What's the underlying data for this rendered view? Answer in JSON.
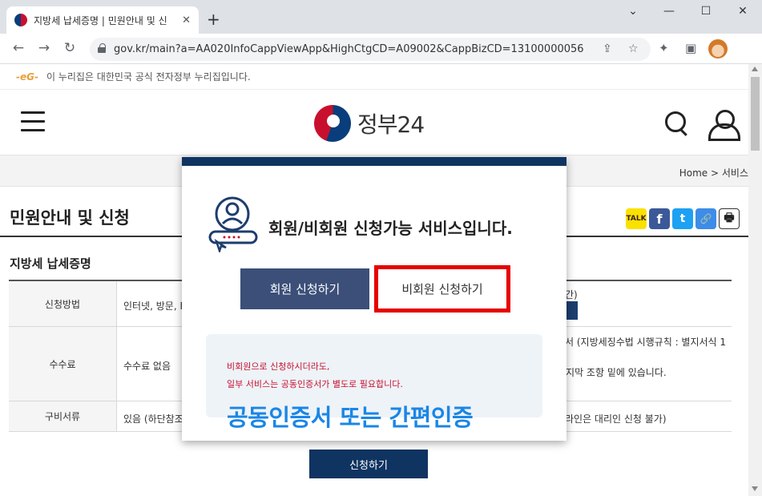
{
  "browser": {
    "tab_title": "지방세 납세증명 | 민원안내 및 신",
    "tab_close": "✕",
    "new_tab": "+",
    "url": "gov.kr/main?a=AA020InfoCappViewApp&HighCtgCD=A09002&CappBizCD=13100000056"
  },
  "banner": {
    "mark": "-eG-",
    "text": "이 누리집은 대한민국 공식 전자정부 누리집입니다."
  },
  "header": {
    "logo_text": "정부24"
  },
  "breadcrumb": "Home  >  서비스",
  "page": {
    "title": "민원안내 및 신청",
    "subtitle": "지방세 납세증명",
    "share": [
      "TALK",
      "f",
      "t",
      "🔗",
      "🖶"
    ],
    "rows": [
      {
        "header": "신청방법",
        "value": "인터넷, 방문, FA",
        "right": "간)"
      },
      {
        "header": "수수료",
        "value": "수수료 없음",
        "right": "서 (지방세징수법 시행규칙 : 별지서식 1",
        "right2": "마지막 조항 밑에 있습니다."
      },
      {
        "header": "구비서류",
        "value": "있음 (하단참조)",
        "right": "라인은 대리인 신청 불가)"
      }
    ],
    "apply_button": "신청하기"
  },
  "modal": {
    "heading": "회원/비회원 신청가능 서비스입니다.",
    "member_button": "회원 신청하기",
    "guest_button": "비회원 신청하기",
    "notice_line1": "비회원으로 신청하시더라도,",
    "notice_line2": "일부 서비스는 공동인증서가 별도로 필요합니다."
  },
  "overlay_caption": "공동인증서 또는 간편인증",
  "colors": {
    "navy": "#0f3461",
    "member_btn": "#3b4f78",
    "highlight_red": "#e60000",
    "caption_blue": "#1a86e6",
    "notice_red": "#c8102e"
  }
}
